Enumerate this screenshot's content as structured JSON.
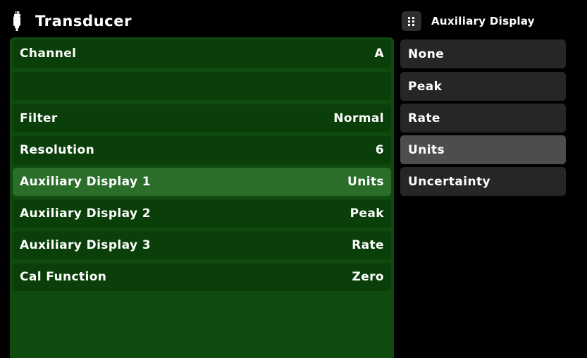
{
  "header": {
    "title": "Transducer",
    "icon": "transducer-icon"
  },
  "aux_panel": {
    "title": "Auxiliary Display",
    "icon": "grid-icon",
    "options": [
      {
        "label": "None",
        "selected": false
      },
      {
        "label": "Peak",
        "selected": false
      },
      {
        "label": "Rate",
        "selected": false
      },
      {
        "label": "Units",
        "selected": true
      },
      {
        "label": "Uncertainty",
        "selected": false
      }
    ]
  },
  "settings": {
    "channel": {
      "label": "Channel",
      "value": "A"
    },
    "filter": {
      "label": "Filter",
      "value": "Normal"
    },
    "resolution": {
      "label": "Resolution",
      "value": "6"
    },
    "aux1": {
      "label": "Auxiliary Display 1",
      "value": "Units"
    },
    "aux2": {
      "label": "Auxiliary Display 2",
      "value": "Peak"
    },
    "aux3": {
      "label": "Auxiliary Display 3",
      "value": "Rate"
    },
    "cal": {
      "label": "Cal Function",
      "value": "Zero"
    }
  },
  "colors": {
    "background": "#000000",
    "panel_green": "#0f4a0f",
    "row_green": "#0a3f0a",
    "row_selected_green": "#2a6e2a",
    "option_bg": "#262626",
    "option_selected_bg": "#4d4d4d",
    "text": "#ffffff"
  }
}
